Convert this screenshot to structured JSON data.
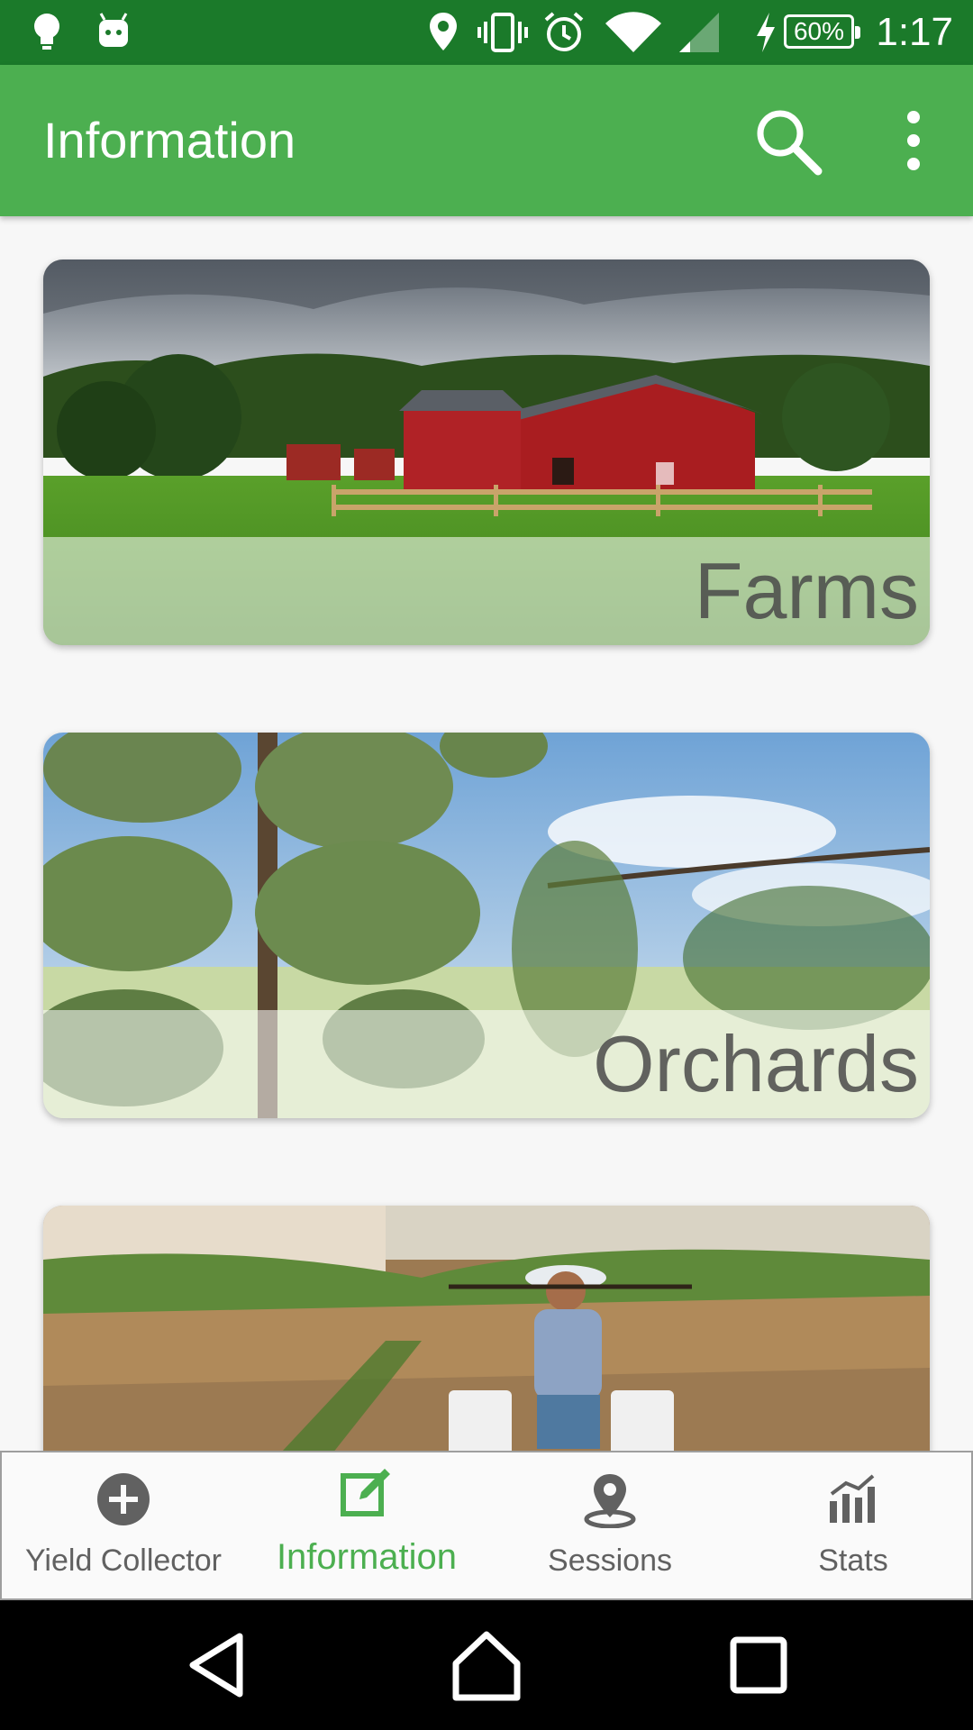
{
  "status_bar": {
    "time": "1:17",
    "battery_percent": "60%",
    "icons": [
      "bulb-icon",
      "android-icon",
      "location-icon",
      "vibrate-icon",
      "alarm-icon",
      "wifi-icon",
      "signal-icon",
      "charging-icon"
    ]
  },
  "app_bar": {
    "title": "Information",
    "actions": [
      "search-icon",
      "more-vert-icon"
    ]
  },
  "cards": [
    {
      "label": "Farms"
    },
    {
      "label": "Orchards"
    },
    {
      "label": ""
    }
  ],
  "bottom_nav": {
    "items": [
      {
        "label": "Yield Collector",
        "icon": "add-circle-icon",
        "active": false
      },
      {
        "label": "Information",
        "icon": "edit-icon",
        "active": true
      },
      {
        "label": "Sessions",
        "icon": "location-pin-icon",
        "active": false
      },
      {
        "label": "Stats",
        "icon": "bar-chart-icon",
        "active": false
      }
    ]
  },
  "colors": {
    "status_bar": "#1b7a2a",
    "app_bar": "#4caf50",
    "active_nav": "#4caf50",
    "inactive_nav": "#616161"
  }
}
